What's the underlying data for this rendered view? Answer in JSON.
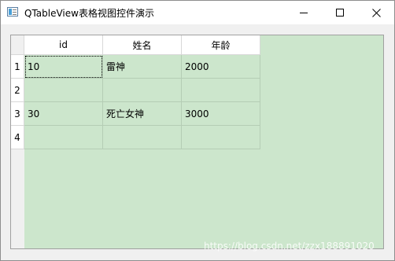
{
  "window": {
    "title": "QTableView表格视图控件演示",
    "minimize_icon": "minimize-icon",
    "maximize_icon": "maximize-icon",
    "close_icon": "close-icon"
  },
  "table": {
    "columns": [
      "id",
      "姓名",
      "年龄"
    ],
    "row_headers": [
      "1",
      "2",
      "3",
      "4"
    ],
    "rows": [
      [
        "10",
        "雷神",
        "2000"
      ],
      [
        "",
        "",
        ""
      ],
      [
        "30",
        "死亡女神",
        "3000"
      ],
      [
        "",
        "",
        ""
      ]
    ],
    "background_color": "#cce6cc",
    "focused_cell": [
      0,
      0
    ]
  },
  "watermark": "https://blog.csdn.net/zzx188891020"
}
